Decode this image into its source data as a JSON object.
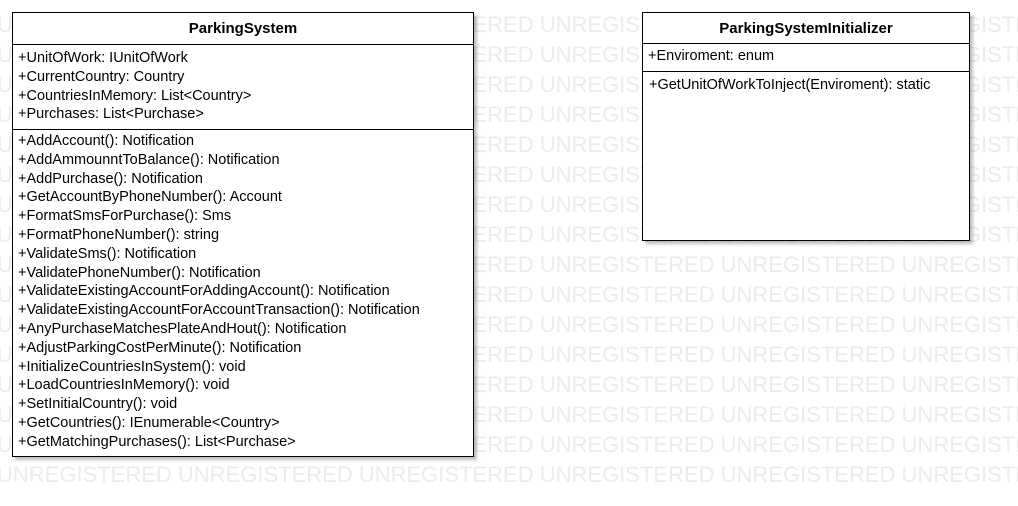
{
  "watermark": {
    "text": "UNREGISTERED UNREGISTERED UNREGISTERED UNREGISTERED UNREGISTERED UNREGISTERED"
  },
  "classes": [
    {
      "name": "ParkingSystem",
      "attributes": [
        "+UnitOfWork: IUnitOfWork",
        "+CurrentCountry: Country",
        "+CountriesInMemory: List<Country>",
        "+Purchases: List<Purchase>"
      ],
      "methods": [
        "+AddAccount(): Notification",
        "+AddAmmounntToBalance(): Notification",
        "+AddPurchase(): Notification",
        "+GetAccountByPhoneNumber(): Account",
        "+FormatSmsForPurchase(): Sms",
        "+FormatPhoneNumber(): string",
        "+ValidateSms(): Notification",
        "+ValidatePhoneNumber(): Notification",
        "+ValidateExistingAccountForAddingAccount(): Notification",
        "+ValidateExistingAccountForAccountTransaction(): Notification",
        "+AnyPurchaseMatchesPlateAndHout(): Notification",
        "+AdjustParkingCostPerMinute(): Notification",
        "+InitializeCountriesInSystem(): void",
        "+LoadCountriesInMemory(): void",
        "+SetInitialCountry(): void",
        "+GetCountries(): IEnumerable<Country>",
        "+GetMatchingPurchases(): List<Purchase>"
      ]
    },
    {
      "name": "ParkingSystemInitializer",
      "attributes": [
        "+Enviroment: enum"
      ],
      "methods": [
        "+GetUnitOfWorkToInject(Enviroment): static"
      ]
    }
  ]
}
